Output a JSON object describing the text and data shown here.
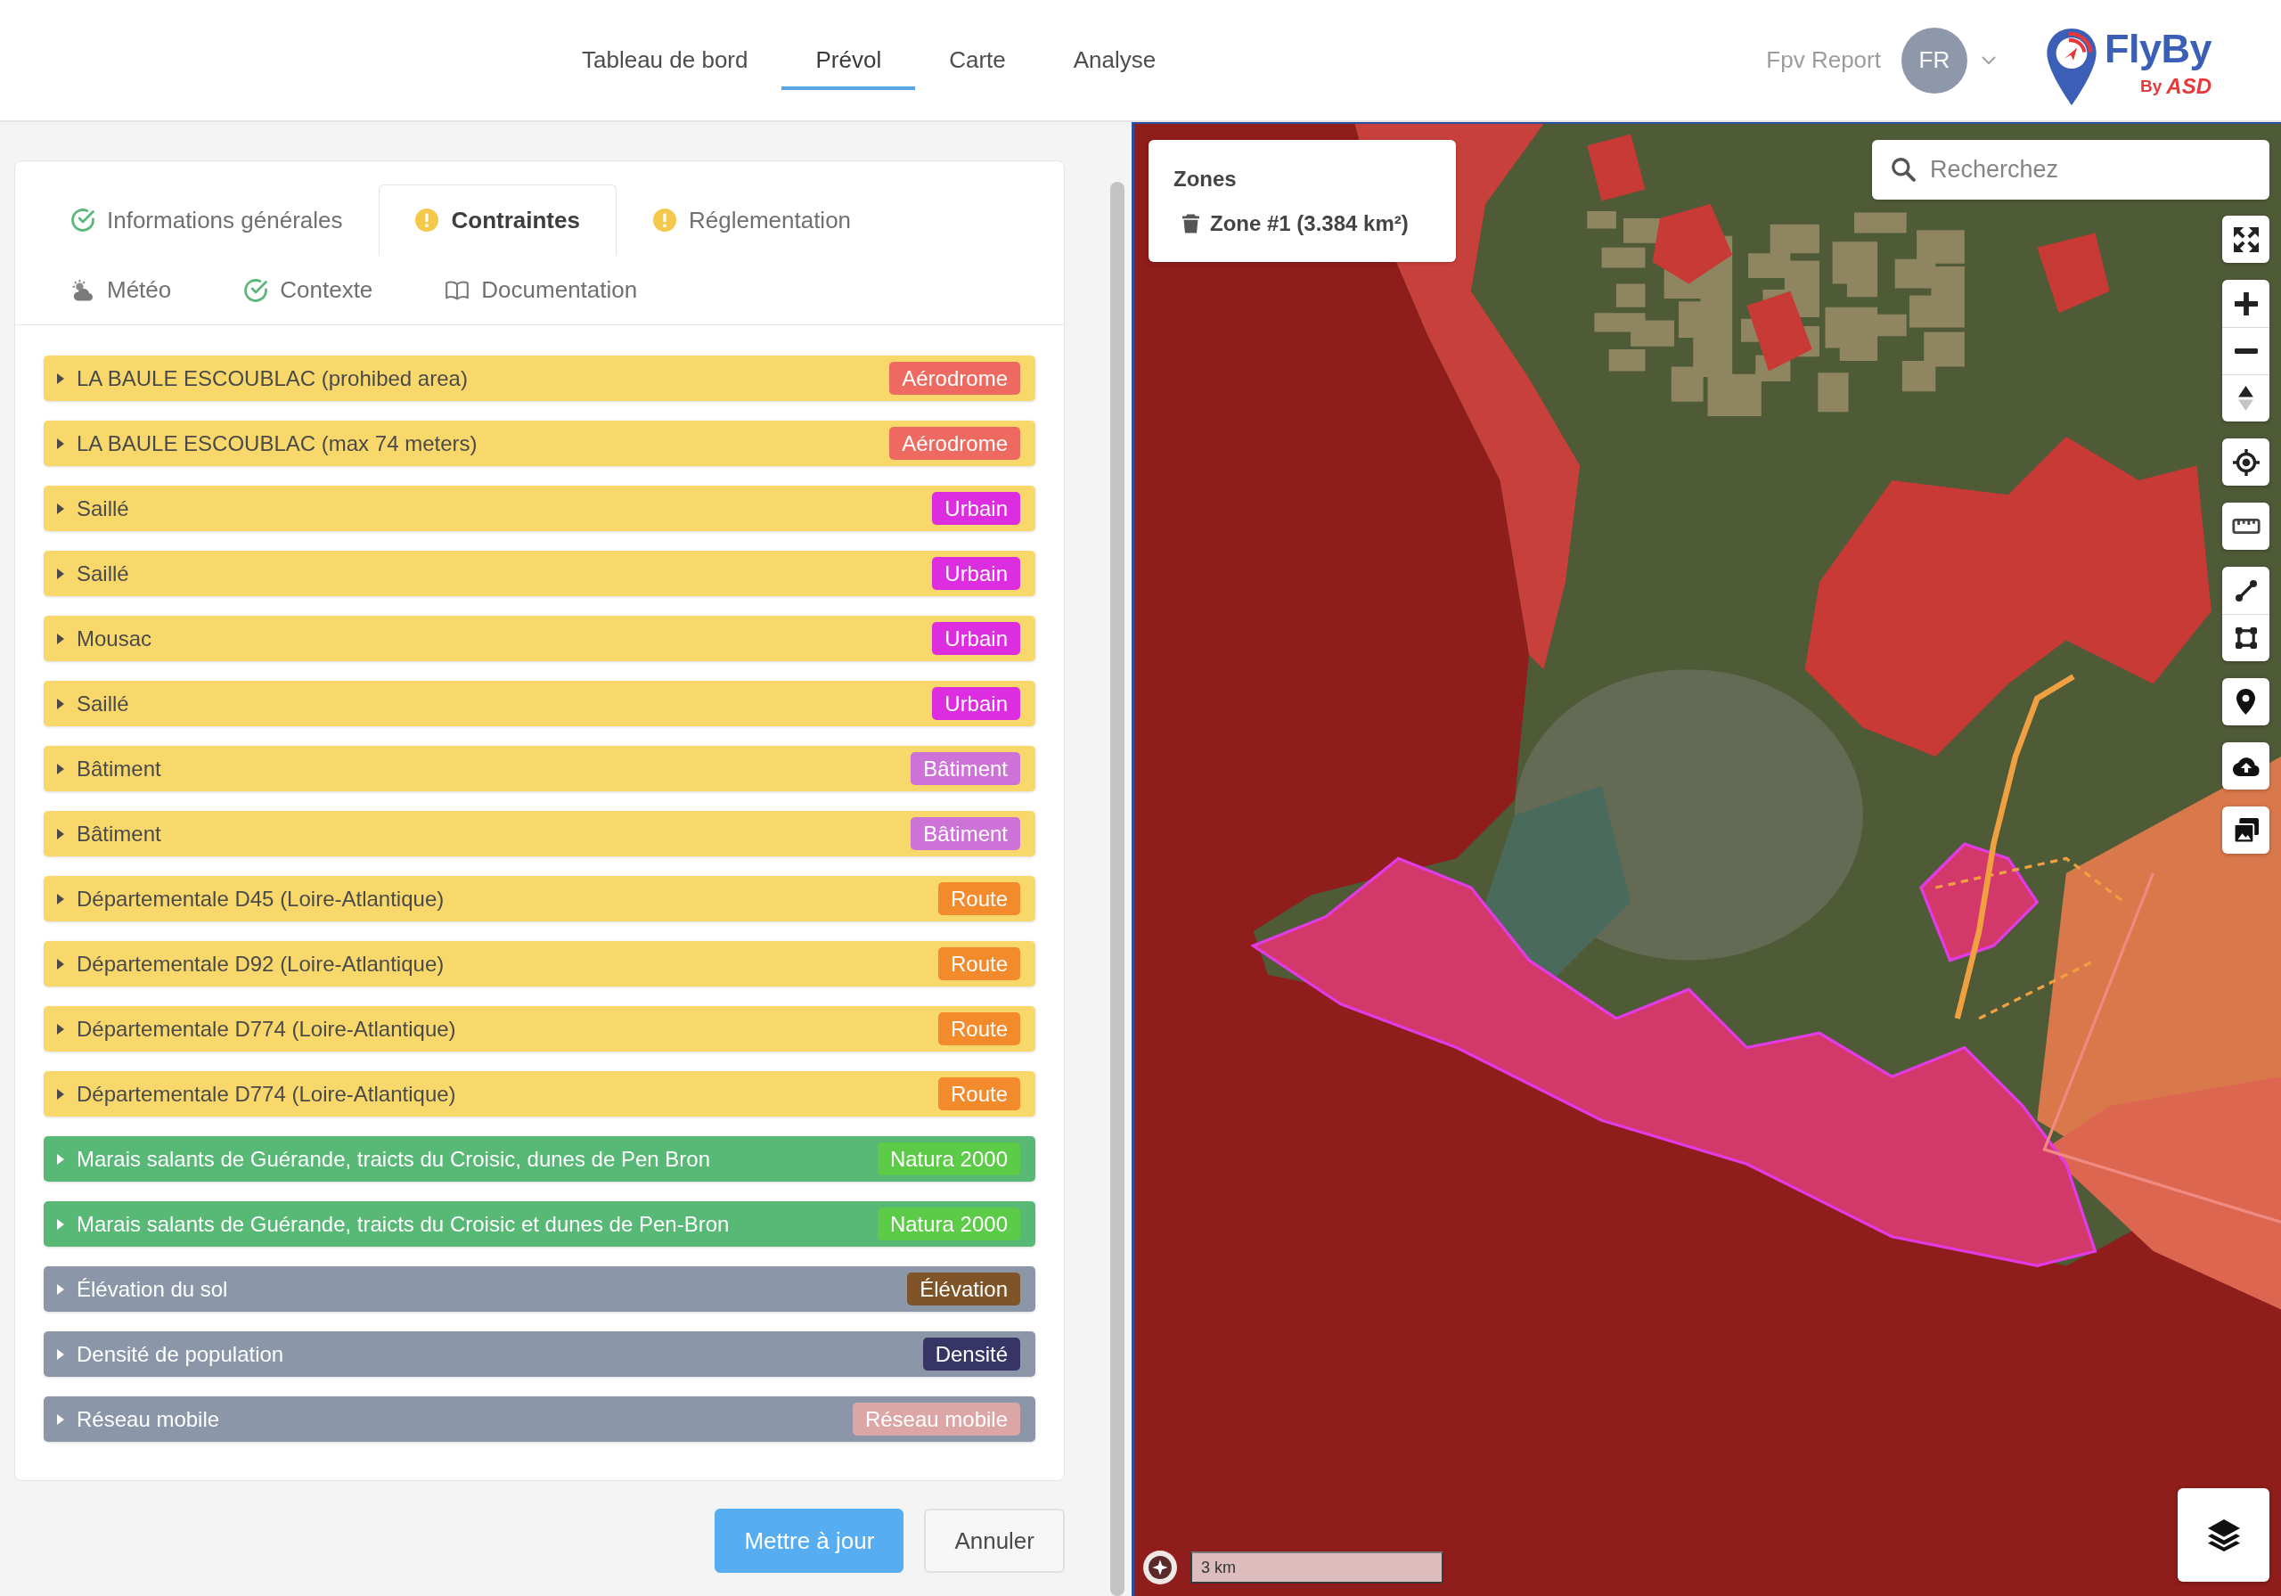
{
  "header": {
    "nav": [
      {
        "label": "Tableau de bord",
        "selected": false
      },
      {
        "label": "Prévol",
        "selected": true
      },
      {
        "label": "Carte",
        "selected": false
      },
      {
        "label": "Analyse",
        "selected": false
      }
    ],
    "user": {
      "name": "Fpv Report",
      "initials": "FR"
    },
    "logo": {
      "title": "FlyBy",
      "by": "By",
      "brand": "ASD"
    }
  },
  "mission_form": {
    "tab_rows": [
      [
        {
          "label": "Informations générales",
          "kind": "step",
          "complete": true,
          "selected": false
        },
        {
          "label": "Contraintes",
          "kind": "step",
          "complete": false,
          "selected": true
        },
        {
          "label": "Réglementation",
          "kind": "step",
          "complete": false,
          "selected": false
        }
      ],
      [
        {
          "label": "Météo",
          "kind": "weather",
          "selected": false
        },
        {
          "label": "Contexte",
          "kind": "step",
          "complete": true,
          "selected": false
        },
        {
          "label": "Documentation",
          "kind": "documentation",
          "selected": false
        }
      ]
    ],
    "constraints": [
      {
        "label": "LA BAULE ESCOUBLAC (prohibed area)",
        "color": "#f8d86b",
        "expanded": false,
        "tag": {
          "label": "Aérodrome",
          "color": "#ee6a60"
        }
      },
      {
        "label": "LA BAULE ESCOUBLAC (max 74 meters)",
        "color": "#f8d86b",
        "expanded": false,
        "tag": {
          "label": "Aérodrome",
          "color": "#ee6a60"
        }
      },
      {
        "label": "Saillé",
        "color": "#f8d86b",
        "expanded": false,
        "tag": {
          "label": "Urbain",
          "color": "#dc2ee0"
        }
      },
      {
        "label": "Saillé",
        "color": "#f8d86b",
        "expanded": false,
        "tag": {
          "label": "Urbain",
          "color": "#dc2ee0"
        }
      },
      {
        "label": "Mousac",
        "color": "#f8d86b",
        "expanded": false,
        "tag": {
          "label": "Urbain",
          "color": "#dc2ee0"
        }
      },
      {
        "label": "Saillé",
        "color": "#f8d86b",
        "expanded": false,
        "tag": {
          "label": "Urbain",
          "color": "#dc2ee0"
        }
      },
      {
        "label": "Bâtiment",
        "color": "#f8d86b",
        "expanded": false,
        "tag": {
          "label": "Bâtiment",
          "color": "#cd72d6"
        }
      },
      {
        "label": "Bâtiment",
        "color": "#f8d86b",
        "expanded": false,
        "tag": {
          "label": "Bâtiment",
          "color": "#cd72d6"
        }
      },
      {
        "label": "Départementale D45 (Loire-Atlantique)",
        "color": "#f8d86b",
        "expanded": false,
        "tag": {
          "label": "Route",
          "color": "#f38a2c"
        }
      },
      {
        "label": "Départementale D92 (Loire-Atlantique)",
        "color": "#f8d86b",
        "expanded": false,
        "tag": {
          "label": "Route",
          "color": "#f38a2c"
        }
      },
      {
        "label": "Départementale D774 (Loire-Atlantique)",
        "color": "#f8d86b",
        "expanded": false,
        "tag": {
          "label": "Route",
          "color": "#f38a2c"
        }
      },
      {
        "label": "Départementale D774 (Loire-Atlantique)",
        "color": "#f8d86b",
        "expanded": false,
        "tag": {
          "label": "Route",
          "color": "#f38a2c"
        }
      },
      {
        "label": "Marais salants de Guérande, traicts du Croisic, dunes de Pen Bron",
        "color": "#58b876",
        "expanded": false,
        "tag": {
          "label": "Natura 2000",
          "color": "#5ccb48"
        }
      },
      {
        "label": "Marais salants de Guérande, traicts du Croisic et dunes de Pen-Bron",
        "color": "#58b876",
        "expanded": false,
        "tag": {
          "label": "Natura 2000",
          "color": "#5ccb48"
        }
      },
      {
        "label": "Élévation du sol",
        "color": "#8b97a9",
        "expanded": false,
        "tag": {
          "label": "Élévation",
          "color": "#7e5428"
        }
      },
      {
        "label": "Densité de population",
        "color": "#8b97a9",
        "expanded": false,
        "tag": {
          "label": "Densité",
          "color": "#363565"
        }
      },
      {
        "label": "Réseau mobile",
        "color": "#8b97a9",
        "expanded": false,
        "tag": {
          "label": "Réseau mobile",
          "color": "#dca6a6"
        }
      }
    ],
    "buttons": [
      {
        "label": "Mettre à jour",
        "kind": "primary"
      },
      {
        "label": "Annuler",
        "kind": "secondary"
      }
    ]
  },
  "map": {
    "zones_panel": {
      "title": "Zones",
      "zones": [
        {
          "label": "Zone #1 (3.384 km²)"
        }
      ]
    },
    "search": {
      "placeholder": "Recherchez"
    },
    "scale": "3 km"
  }
}
